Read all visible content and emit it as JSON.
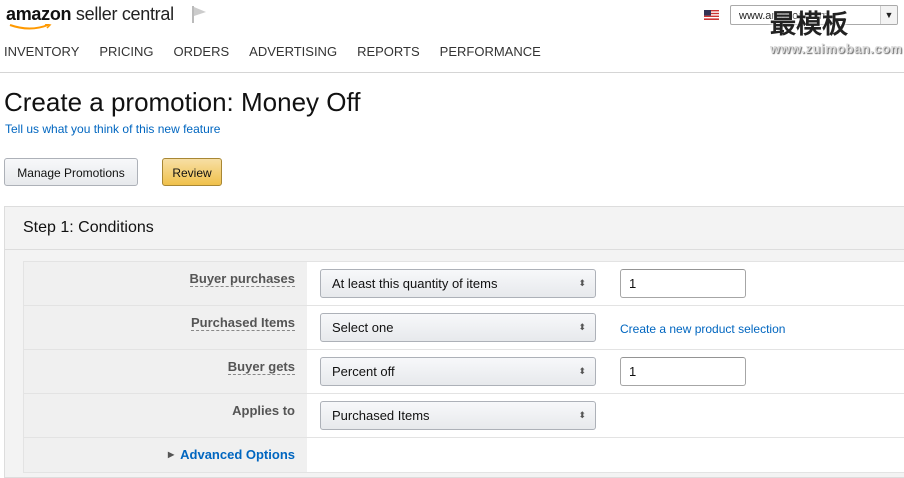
{
  "header": {
    "logo_brand": "amazon",
    "logo_product": "seller central",
    "site_value": "www.amazon.com",
    "watermark": "最模板",
    "watermark_sub": "www.zuimoban.com",
    "nav": [
      "INVENTORY",
      "PRICING",
      "ORDERS",
      "ADVERTISING",
      "REPORTS",
      "PERFORMANCE"
    ]
  },
  "page": {
    "title": "Create a promotion: Money Off",
    "feedback_link": "Tell us what you think of this new feature",
    "manage_button": "Manage Promotions",
    "review_button": "Review"
  },
  "step": {
    "title": "Step 1: Conditions",
    "rows": [
      {
        "label": "Buyer purchases",
        "select": "At least this quantity of items",
        "input": "1"
      },
      {
        "label": "Purchased Items",
        "select": "Select one",
        "link": "Create a new product selection"
      },
      {
        "label": "Buyer gets",
        "select": "Percent off",
        "input": "1"
      },
      {
        "label": "Applies to",
        "select": "Purchased Items"
      }
    ],
    "advanced": "Advanced Options"
  },
  "icons": {
    "flag": "flag-icon",
    "us_flag": "us-flag-icon",
    "select_arrows": "updown-arrows-icon",
    "expand": "triangle-right-icon"
  },
  "colors": {
    "link": "#0066c0",
    "review_button": "#f0c14b",
    "panel_bg": "#f3f3f3"
  }
}
